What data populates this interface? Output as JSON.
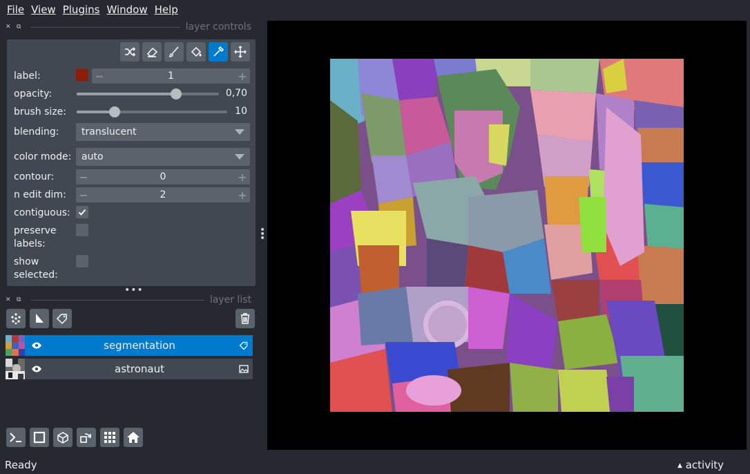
{
  "menu": [
    "File",
    "View",
    "Plugins",
    "Window",
    "Help"
  ],
  "layer_controls": {
    "title": "layer controls",
    "tools": [
      "shuffle-icon",
      "eraser-icon",
      "paintbrush-icon",
      "fill-bucket-icon",
      "color-picker-icon",
      "move-icon"
    ],
    "active_tool": "color-picker-icon",
    "label": {
      "label": "label:",
      "value": "1",
      "swatch_color": "#8a1e0b"
    },
    "opacity": {
      "label": "opacity:",
      "value": "0,70",
      "fraction": 0.7
    },
    "brush_size": {
      "label": "brush size:",
      "value": "10",
      "fraction": 0.25
    },
    "blending": {
      "label": "blending:",
      "value": "translucent"
    },
    "color_mode": {
      "label": "color mode:",
      "value": "auto"
    },
    "contour": {
      "label": "contour:",
      "value": "0"
    },
    "n_edit_dim": {
      "label": "n edit dim:",
      "value": "2"
    },
    "contiguous": {
      "label": "contiguous:",
      "checked": true
    },
    "preserve_labels": {
      "label": "preserve labels:",
      "label_line1": "preserve",
      "label_line2": "labels:",
      "checked": false
    },
    "show_selected": {
      "label": "show selected:",
      "label_line1": "show",
      "label_line2": "selected:",
      "checked": false
    }
  },
  "layer_list": {
    "title": "layer list",
    "layers": [
      {
        "name": "segmentation",
        "type_icon": "label-tag-icon",
        "selected": true,
        "visible": true
      },
      {
        "name": "astronaut",
        "type_icon": "image-icon",
        "selected": false,
        "visible": true
      }
    ]
  },
  "status": {
    "text": "Ready",
    "activity": "activity"
  },
  "colors": {
    "accent": "#007acc",
    "background": "#262930",
    "panel": "#414851"
  }
}
